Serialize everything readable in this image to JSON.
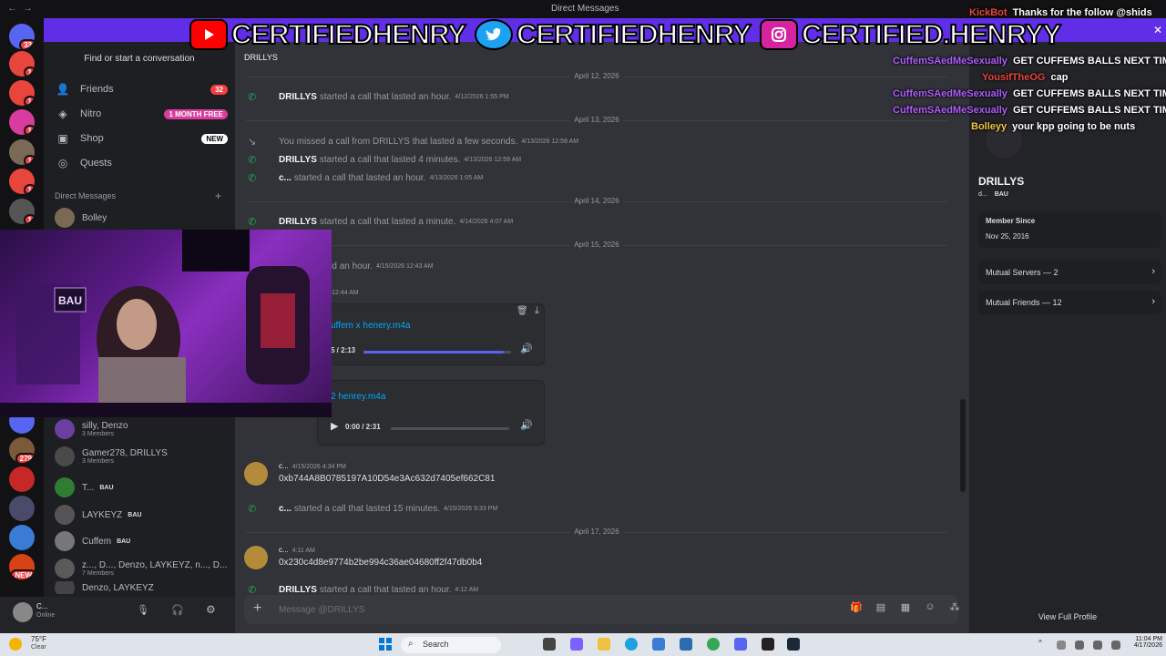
{
  "window": {
    "title": "Direct Messages",
    "nav_back": "←",
    "nav_forward": "→"
  },
  "banner": {
    "handles": [
      {
        "platform": "youtube-icon",
        "handle": "CERTIFIEDHENRY",
        "color": "#ff0000"
      },
      {
        "platform": "twitter-icon",
        "handle": "CERTIFIEDHENRY",
        "color": "#1da1f2"
      },
      {
        "platform": "instagram-icon",
        "handle": "CERTIFIED.HENRYY",
        "color": "#d6249f"
      }
    ]
  },
  "servers": [
    {
      "name": "home",
      "badge": "33"
    },
    {
      "name": "server-1",
      "badge": "1"
    },
    {
      "name": "server-2",
      "badge": "1"
    },
    {
      "name": "server-3",
      "badge": "1"
    },
    {
      "name": "server-4",
      "badge": "1"
    },
    {
      "name": "server-5",
      "badge": "1"
    },
    {
      "name": "server-6",
      "badge": "1"
    },
    {
      "name": "server-7",
      "badge": ""
    },
    {
      "name": "server-8",
      "badge": "279"
    },
    {
      "name": "server-9",
      "badge": ""
    },
    {
      "name": "server-10",
      "badge": ""
    },
    {
      "name": "server-11",
      "badge": ""
    },
    {
      "name": "server-12",
      "badge": "NEW"
    }
  ],
  "sidebar": {
    "find": "Find or start a conversation",
    "nav": [
      {
        "label": "Friends",
        "icon": "friends-icon",
        "pill": "32",
        "pill_color": "#f23f43"
      },
      {
        "label": "Nitro",
        "icon": "nitro-icon",
        "pill": "1 MONTH FREE",
        "pill_color": "#d83c9e"
      },
      {
        "label": "Shop",
        "icon": "shop-icon",
        "pill": "NEW",
        "pill_color": "#ffffff"
      },
      {
        "label": "Quests",
        "icon": "quests-icon",
        "pill": "",
        "pill_color": ""
      }
    ],
    "dm_header": "Direct Messages",
    "dms": [
      {
        "name": "Bolley",
        "sub": "",
        "tag": ""
      },
      {
        "name": "silly, Denzo",
        "sub": "3 Members",
        "tag": ""
      },
      {
        "name": "Gamer278, DRILLYS",
        "sub": "3 Members",
        "tag": ""
      },
      {
        "name": "T...",
        "sub": "",
        "tag": "BAU"
      },
      {
        "name": "LAYKEYZ",
        "sub": "",
        "tag": "BAU"
      },
      {
        "name": "Cuffem",
        "sub": "",
        "tag": "BAU"
      },
      {
        "name": "z..., D..., Denzo, LAYKEYZ, n..., D...",
        "sub": "7 Members",
        "tag": ""
      },
      {
        "name": "Denzo, LAYKEYZ",
        "sub": "",
        "tag": ""
      }
    ]
  },
  "user_panel": {
    "name": "C...",
    "status": "Online"
  },
  "chat": {
    "channel": "DRILLYS",
    "placeholder": "Message @DRILLYS",
    "dates": [
      "April 12, 2026",
      "April 13, 2026",
      "April 14, 2026",
      "April 15, 2026",
      "April 17, 2026"
    ],
    "calls": [
      {
        "who": "DRILLYS",
        "text": "started a call that lasted an hour.",
        "ts": "4/12/2026 1:55 PM",
        "missed": false
      },
      {
        "who": "",
        "text": "You missed a call from DRILLYS that lasted a few seconds.",
        "ts": "4/13/2026 12:58 AM",
        "missed": true
      },
      {
        "who": "DRILLYS",
        "text": "started a call that lasted 4 minutes.",
        "ts": "4/13/2026 12:59 AM",
        "missed": false
      },
      {
        "who": "c...",
        "text": "started a call that lasted an hour.",
        "ts": "4/13/2026 1:05 AM",
        "missed": false
      },
      {
        "who": "DRILLYS",
        "text": "started a call that lasted a minute.",
        "ts": "4/14/2026 4:07 AM",
        "missed": false
      },
      {
        "who": "",
        "text": "call that lasted an hour.",
        "ts": "4/15/2026 12:43 AM",
        "missed": false
      },
      {
        "who": "c...",
        "text": "started a call that lasted 15 minutes.",
        "ts": "4/15/2026 9:33 PM",
        "missed": false
      },
      {
        "who": "DRILLYS",
        "text": "started a call that lasted an hour.",
        "ts": "4:12 AM",
        "missed": false
      }
    ],
    "attachments": [
      {
        "file": "uffem x henery.m4a",
        "time": "5 / 2:13",
        "progress": 0.95
      },
      {
        "file": "2 henrey.m4a",
        "time": "0:00 / 2:31",
        "progress": 0.0
      }
    ],
    "attach_ts": "12:44 AM",
    "messages": [
      {
        "author": "c...",
        "ts": "4/15/2026 4:34 PM",
        "text": "0xb744A8B0785197A10D54e3Ac632d7405ef662C81"
      },
      {
        "author": "c...",
        "ts": "4:11 AM",
        "text": "0x230c4d8e9774b2be994c36ae04680ff2f47db0b4"
      }
    ]
  },
  "profile": {
    "name": "DRILLYS",
    "sub": "d...",
    "tag": "BAU",
    "member_since_label": "Member Since",
    "member_since": "Nov 25, 2016",
    "mutual_servers": "Mutual Servers — 2",
    "mutual_friends": "Mutual Friends — 12",
    "view_full": "View Full Profile"
  },
  "stream_chat": [
    {
      "user": "KickBot",
      "text": "Thanks for the follow @shids",
      "color": "#e8453c"
    },
    {
      "user": "CuffemSAedMeSexually",
      "text": "GET CUFFEMS BALLS NEXT TIME",
      "color": "#b05cff"
    },
    {
      "user": "YousifTheOG",
      "text": "cap",
      "color": "#e8453c"
    },
    {
      "user": "CuffemSAedMeSexually",
      "text": "GET CUFFEMS BALLS NEXT TIME",
      "color": "#b05cff"
    },
    {
      "user": "CuffemSAedMeSexually",
      "text": "GET CUFFEMS BALLS NEXT TIME",
      "color": "#b05cff"
    },
    {
      "user": "Bolleyy",
      "text": "your kpp going to be nuts",
      "color": "#f0c640"
    }
  ],
  "taskbar": {
    "weather": "75°F",
    "weather_desc": "Clear",
    "search": "Search",
    "time": "11:04 PM",
    "date": "4/17/2026"
  }
}
